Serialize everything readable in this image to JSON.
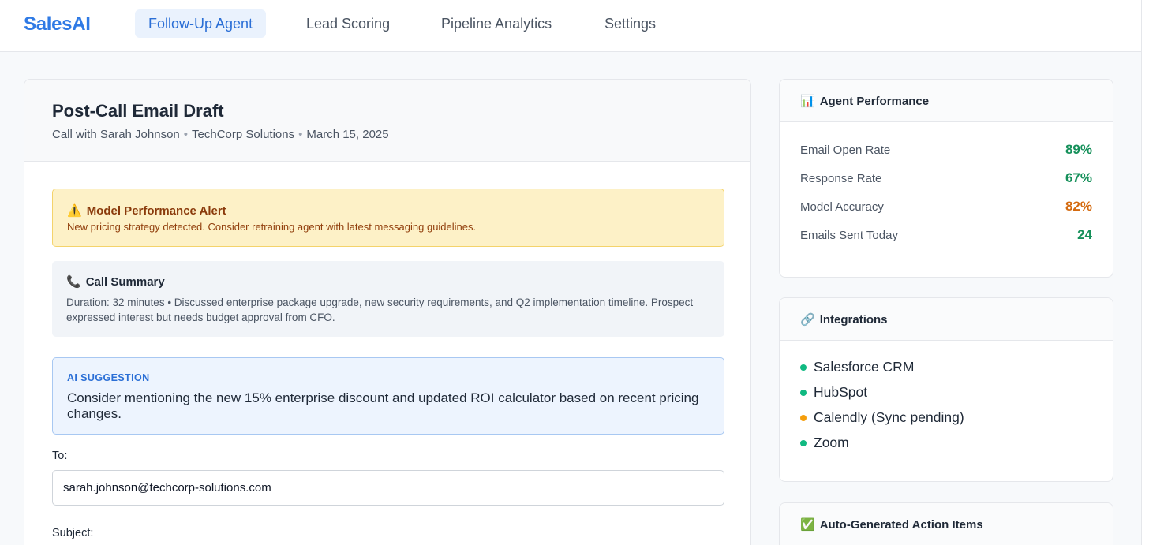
{
  "app": {
    "brand": "SalesAI"
  },
  "nav": {
    "tabs": [
      {
        "label": "Follow-Up Agent",
        "active": true
      },
      {
        "label": "Lead Scoring",
        "active": false
      },
      {
        "label": "Pipeline Analytics",
        "active": false
      },
      {
        "label": "Settings",
        "active": false
      }
    ]
  },
  "draft": {
    "title": "Post-Call Email Draft",
    "meta": [
      "Call with Sarah Johnson",
      "TechCorp Solutions",
      "March 15, 2025"
    ],
    "separator": "•",
    "alert": {
      "icon": "⚠️",
      "title": "Model Performance Alert",
      "text": "New pricing strategy detected. Consider retraining agent with latest messaging guidelines."
    },
    "summary": {
      "icon": "📞",
      "title": "Call Summary",
      "text": "Duration: 32 minutes • Discussed enterprise package upgrade, new security requirements, and Q2 implementation timeline. Prospect expressed interest but needs budget approval from CFO."
    },
    "suggestion": {
      "label": "AI SUGGESTION",
      "text": "Consider mentioning the new 15% enterprise discount and updated ROI calculator based on recent pricing changes."
    },
    "to_label": "To:",
    "to_value": "sarah.johnson@techcorp-solutions.com",
    "subject_label": "Subject:"
  },
  "performance": {
    "icon": "📊",
    "title": "Agent Performance",
    "metrics": [
      {
        "label": "Email Open Rate",
        "value": "89%",
        "color": "#15905a"
      },
      {
        "label": "Response Rate",
        "value": "67%",
        "color": "#15905a"
      },
      {
        "label": "Model Accuracy",
        "value": "82%",
        "color": "#d46a0f"
      },
      {
        "label": "Emails Sent Today",
        "value": "24",
        "color": "#15905a"
      }
    ]
  },
  "integrations": {
    "icon": "🔗",
    "title": "Integrations",
    "items": [
      {
        "name": "Salesforce CRM",
        "status_color": "#10b981"
      },
      {
        "name": "HubSpot",
        "status_color": "#10b981"
      },
      {
        "name": "Calendly (Sync pending)",
        "status_color": "#f59e0b"
      },
      {
        "name": "Zoom",
        "status_color": "#10b981"
      }
    ]
  },
  "actions": {
    "icon": "✅",
    "title": "Auto-Generated Action Items"
  }
}
